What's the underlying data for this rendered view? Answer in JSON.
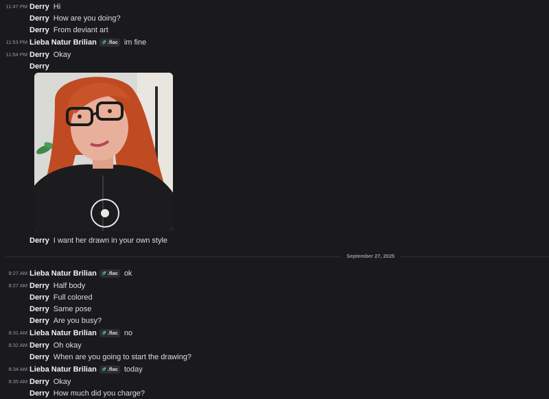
{
  "divider": {
    "date": "September 27, 2025"
  },
  "messages": [
    {
      "time": "11:47 PM",
      "author": "Derry",
      "text": "Hi"
    },
    {
      "time": "",
      "author": "Derry",
      "text": "How are you doing?"
    },
    {
      "time": "",
      "author": "Derry",
      "text": "From deviant art"
    },
    {
      "time": "11:53 PM",
      "author": "Lieba Natur Brilian",
      "tag": ".flac",
      "text": "im  fine"
    },
    {
      "time": "11:54 PM",
      "author": "Derry",
      "text": "Okay"
    },
    {
      "time": "",
      "author": "Derry",
      "text": ""
    },
    {
      "time": "",
      "author": "Derry",
      "text": "I want her drawn in your own style"
    },
    {
      "time": "8:27 AM",
      "author": "Lieba Natur Brilian",
      "tag": ".flac",
      "text": "ok"
    },
    {
      "time": "8:27 AM",
      "author": "Derry",
      "text": "Half body"
    },
    {
      "time": "",
      "author": "Derry",
      "text": "Full colored"
    },
    {
      "time": "",
      "author": "Derry",
      "text": "Same pose"
    },
    {
      "time": "",
      "author": "Derry",
      "text": "Are you busy?"
    },
    {
      "time": "8:31 AM",
      "author": "Lieba Natur Brilian",
      "tag": ".flac",
      "text": "no"
    },
    {
      "time": "8:32 AM",
      "author": "Derry",
      "text": "Oh okay"
    },
    {
      "time": "",
      "author": "Derry",
      "text": "When are you going to start the drawing?"
    },
    {
      "time": "8:34 AM",
      "author": "Lieba Natur Brilian",
      "tag": ".flac",
      "text": "today"
    },
    {
      "time": "8:35 AM",
      "author": "Derry",
      "text": "Okay"
    },
    {
      "time": "",
      "author": "Derry",
      "text": "How much did you charge?"
    }
  ],
  "icons": {
    "tag_icon": "leaf-icon",
    "attachment": "photo-attachment"
  },
  "colors": {
    "background": "#1a1a1e",
    "author": "#f2f3f5",
    "timestamp": "#949ba4",
    "text": "#dbdee1",
    "tag_bg": "#2b2d31"
  }
}
